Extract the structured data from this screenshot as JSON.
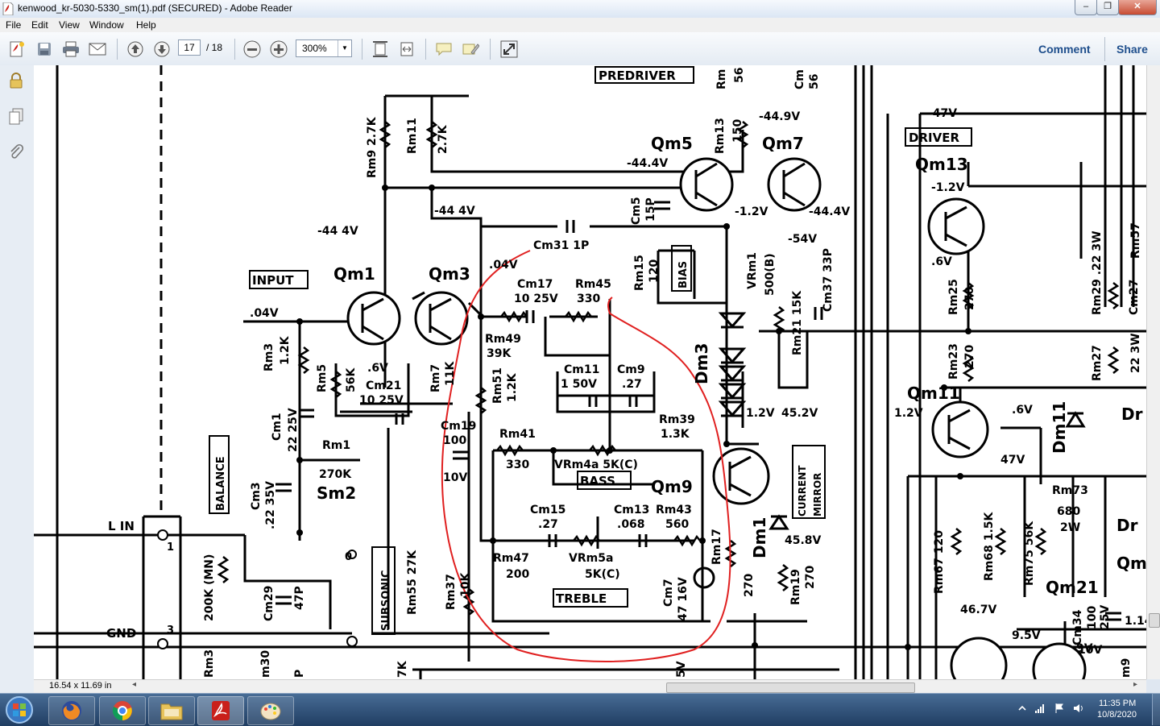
{
  "window": {
    "title": "kenwood_kr-5030-5330_sm(1).pdf (SECURED) - Adobe Reader",
    "minimize_glyph": "–",
    "maximize_glyph": "❐",
    "close_glyph": "✕"
  },
  "menu": {
    "file": "File",
    "edit": "Edit",
    "view": "View",
    "window": "Window",
    "help": "Help"
  },
  "toolbar": {
    "page_current": "17",
    "page_total": "/ 18",
    "zoom": "300%",
    "comment_label": "Comment",
    "share_label": "Share"
  },
  "status": {
    "doc_size": "16.54 x 11.69 in"
  },
  "taskbar": {
    "time": "11:35 PM",
    "date": "10/8/2020"
  },
  "schematic": {
    "labels": {
      "predriver": "PREDRIVER",
      "driver": "DRIVER",
      "input": "INPUT",
      "bias": "BIAS",
      "bass": "BASS",
      "treble": "TREBLE",
      "balance": "BALANCE",
      "subsonic": "SUBSONIC",
      "current_mirror_1": "CURRENT",
      "current_mirror_2": "MIRROR",
      "l_in": "L IN",
      "gnd": "GND",
      "pin1": "1",
      "pin3": "3",
      "pin0": "0"
    },
    "transistors": {
      "qm1": "Qm1",
      "qm3": "Qm3",
      "qm5": "Qm5",
      "qm7": "Qm7",
      "qm9": "Qm9",
      "qm11": "Qm11",
      "qm13": "Qm13",
      "qm21": "Qm21",
      "sm2": "Sm2",
      "dm3": "Dm3",
      "dm1": "Dm1",
      "dm11": "Dm11",
      "dr": "Dr",
      "dr2": "Dr",
      "qm_edge": "Qm"
    },
    "components": {
      "rm9": "Rm9 2.7K",
      "rm11": "Rm11",
      "rm11_val": "2.7K",
      "rm13": "Rm13",
      "rm13_val": "150",
      "rm_top": "Rm",
      "rm_top_val": "56",
      "cm_top": "Cm",
      "cm_top_val": "56",
      "cm31": "Cm31 1P",
      "cm17": "Cm17",
      "cm17_val": "10 25V",
      "rm45": "Rm45",
      "rm45_val": "330",
      "cm5": "Cm5",
      "cm5_val": "15P",
      "rm15": "Rm15",
      "rm15_val": "120",
      "vrm1": "VRm1",
      "vrm1_val": "500(B)",
      "rm21": "Rm21 15K",
      "cm37": "Cm37 33P",
      "rm25": "Rm25",
      "rm25_val": "270",
      "rm23": "Rm23",
      "rm23_val": "270",
      "rm29": "Rm29 .22 3W",
      "rm57": "Rm57",
      "cm27": "Cm27",
      "rm27": "Rm27",
      "rm27_val": "22 3W",
      "rm49": "Rm49",
      "rm49_val": "39K",
      "rm3": "Rm3",
      "rm3_val": "1.2K",
      "rm5": "Rm5",
      "rm5_val": "56K",
      "cm21": "Cm21",
      "cm21_val": "10 25V",
      "rm7": "Rm7",
      "rm7_val": "11K",
      "rm51": "Rm51",
      "rm51_val": "1.2K",
      "cm11": "Cm11",
      "cm11_val": "1 50V",
      "cm9": "Cm9",
      "cm9_val": ".27",
      "rm39": "Rm39",
      "rm39_val": "1.3K",
      "cm1": "Cm1",
      "cm1_val": "22 25V",
      "rm1": "Rm1",
      "rm1_val": "270K",
      "cm19": "Cm19",
      "cm19_val": "100",
      "cm19_v": "10V",
      "rm41": "Rm41",
      "rm41_val": "330",
      "vrm4": "VRm4a 5K(C)",
      "cm3": "Cm3",
      "cm3_val": ".22 35V",
      "cm15": "Cm15",
      "cm15_val": ".27",
      "cm13": "Cm13",
      "cm13_val": ".068",
      "rm43": "Rm43",
      "rm43_val": "560",
      "rm17": "Rm17",
      "rm17_val": "270",
      "rm47": "Rm47",
      "rm47_val": "200",
      "vrm5": "VRm5a",
      "vrm5_val": "5K(C)",
      "cm7": "Cm7",
      "cm7_val": "47 16V",
      "rm37": "Rm37",
      "rm37_val": "10K",
      "rm55": "Rm55 27K",
      "pot": "200K (MN)",
      "cm29": "Cm29",
      "cm29_val": "47P",
      "rm19": "Rm19",
      "rm19_val": "270",
      "rm67": "Rm67 120",
      "rm68": "Rm68 1.5K",
      "rm75": "Rm75 56K",
      "rm73": "Rm73",
      "rm73_val": "680",
      "rm73_w": "2W",
      "cm34": "Cm34",
      "cm34_val": "100",
      "cm34_v": "25V",
      "rm3b": "Rm3",
      "rm30": "m30",
      "p_bot": "P",
      "k_bot": "7K",
      "v_bot": "5V",
      "m9": "m9",
      "v_bot2": "1.14",
      "v_bot3": "10V"
    },
    "voltages": {
      "v_449": "-44.9V",
      "v_47": "-47V",
      "v_444a": "-44.4V",
      "v_444b": "-44 4V",
      "v_444c": "-44 4V",
      "v_12": "-1.2V",
      "v_444d": "-44.4V",
      "v_54": "-54V",
      "v_12b": "-1.2V",
      "v_6": ".6V",
      "v_04": ".04V",
      "v_04b": ".04V",
      "v_6b": ".6V",
      "v_12c": "1.2V",
      "v_452": "45.2V",
      "v_12d": "1.2V",
      "v_6c": ".6V",
      "v_47b": "47V",
      "v_458": "45.8V",
      "v_467": "46.7V",
      "v_95": "9.5V",
      "v_9": "9V"
    }
  }
}
